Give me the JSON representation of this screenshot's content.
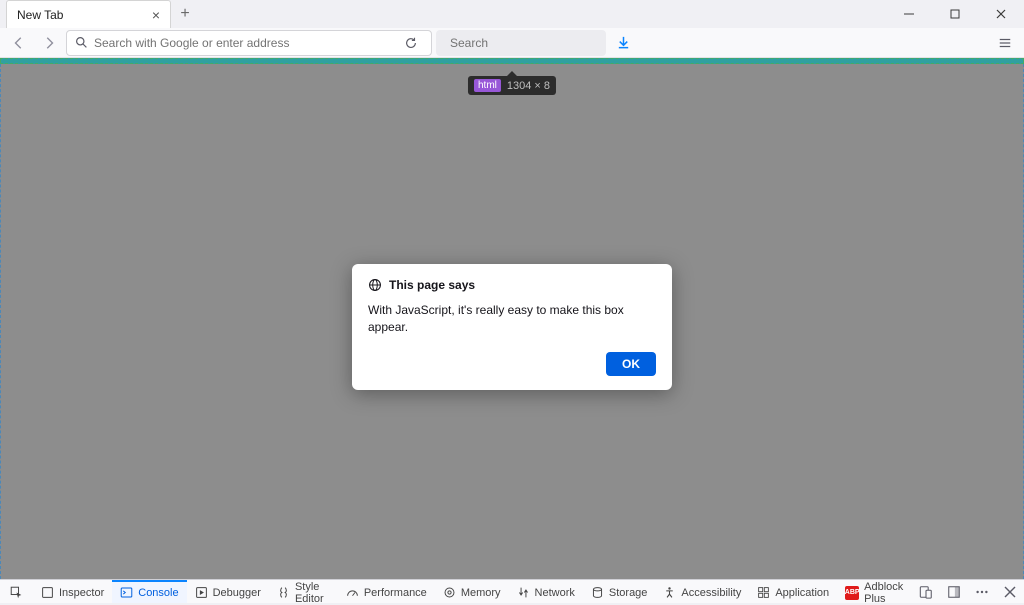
{
  "tab": {
    "title": "New Tab"
  },
  "urlbar": {
    "placeholder": "Search with Google or enter address"
  },
  "searchbar": {
    "placeholder": "Search"
  },
  "tooltip": {
    "tag": "html",
    "dimensions": "1304 × 8"
  },
  "dialog": {
    "header": "This page says",
    "message": "With JavaScript, it's really easy to make this box appear.",
    "ok": "OK"
  },
  "devtools": {
    "inspector": "Inspector",
    "console": "Console",
    "debugger": "Debugger",
    "style_editor": "Style Editor",
    "performance": "Performance",
    "memory": "Memory",
    "network": "Network",
    "storage": "Storage",
    "accessibility": "Accessibility",
    "application": "Application",
    "adblock": "Adblock Plus"
  }
}
